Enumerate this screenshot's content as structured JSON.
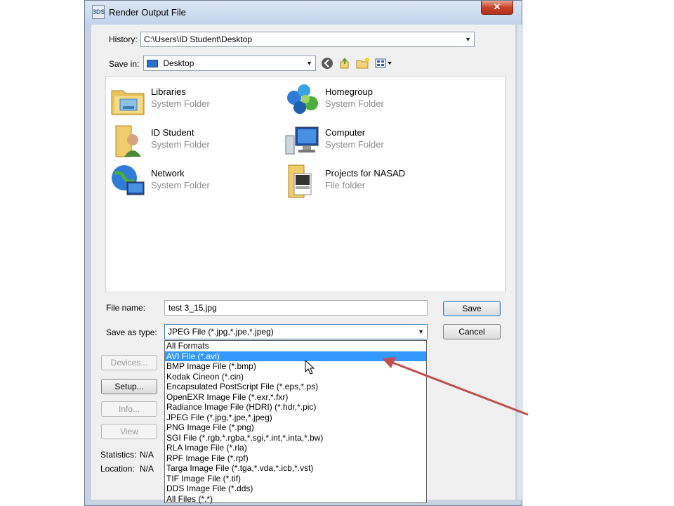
{
  "window": {
    "title": "Render Output File",
    "app_icon_text": "3DS",
    "close_glyph": "✕"
  },
  "history": {
    "label": "History:",
    "value": "C:\\Users\\ID Student\\Desktop"
  },
  "save_in": {
    "label": "Save in:",
    "value": "Desktop"
  },
  "toolbar": {
    "icons": [
      "back-icon",
      "up-folder-icon",
      "new-folder-icon",
      "view-menu-icon"
    ]
  },
  "files": [
    {
      "name": "Libraries",
      "type": "System Folder",
      "icon": "libraries-icon"
    },
    {
      "name": "Homegroup",
      "type": "System Folder",
      "icon": "homegroup-icon"
    },
    {
      "name": "ID Student",
      "type": "System Folder",
      "icon": "user-folder-icon"
    },
    {
      "name": "Computer",
      "type": "System Folder",
      "icon": "computer-icon"
    },
    {
      "name": "Network",
      "type": "System Folder",
      "icon": "network-icon"
    },
    {
      "name": "Projects for NASAD",
      "type": "File folder",
      "icon": "folder-icon"
    }
  ],
  "filename": {
    "label": "File name:",
    "value": "test 3_15.jpg"
  },
  "save_as_type": {
    "label": "Save as type:",
    "value": "JPEG File (*.jpg,*.jpe,*.jpeg)",
    "options": [
      "All Formats",
      "AVI File (*.avi)",
      "BMP Image File (*.bmp)",
      "Kodak Cineon (*.cin)",
      "Encapsulated PostScript File (*.eps,*.ps)",
      "OpenEXR Image File (*.exr,*.fxr)",
      "Radiance Image File (HDRI) (*.hdr,*.pic)",
      "JPEG File (*.jpg,*.jpe,*.jpeg)",
      "PNG Image File (*.png)",
      "SGI File (*.rgb,*.rgba,*.sgi,*.int,*.inta,*.bw)",
      "RLA Image File (*.rla)",
      "RPF Image File (*.rpf)",
      "Targa Image File (*.tga,*.vda,*.icb,*.vst)",
      "TIF Image File (*.tif)",
      "DDS Image File (*.dds)",
      "All Files (*.*)"
    ],
    "highlighted_index": 1
  },
  "buttons": {
    "save": "Save",
    "cancel": "Cancel",
    "devices": "Devices...",
    "setup": "Setup...",
    "info": "Info...",
    "view": "View"
  },
  "stats": {
    "statistics_label": "Statistics:",
    "statistics_value": "N/A",
    "location_label": "Location:",
    "location_value": "N/A"
  },
  "colors": {
    "highlight": "#3399ff",
    "annotation_arrow": "#c0504d"
  }
}
